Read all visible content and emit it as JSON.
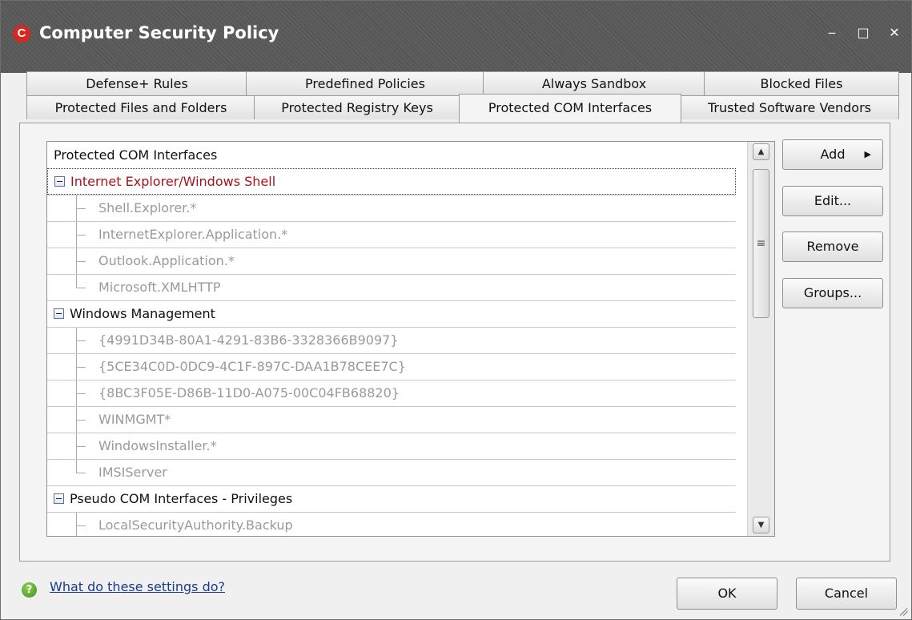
{
  "window": {
    "title": "Computer Security Policy",
    "logo_letter": "C",
    "controls": {
      "minimize": "‒",
      "maximize": "□",
      "close": "✕"
    }
  },
  "tabs": {
    "back_row": [
      "Defense+ Rules",
      "Predefined Policies",
      "Always Sandbox",
      "Blocked Files"
    ],
    "front_row": [
      "Protected Files and Folders",
      "Protected Registry Keys",
      "Protected COM Interfaces",
      "Trusted Software Vendors"
    ],
    "active": "Protected COM Interfaces"
  },
  "tree": {
    "header": "Protected COM Interfaces",
    "groups": [
      {
        "label": "Internet Explorer/Windows Shell",
        "selected": true,
        "items": [
          "Shell.Explorer.*",
          "InternetExplorer.Application.*",
          "Outlook.Application.*",
          "Microsoft.XMLHTTP"
        ]
      },
      {
        "label": "Windows Management",
        "selected": false,
        "items": [
          "{4991D34B-80A1-4291-83B6-3328366B9097}",
          "{5CE34C0D-0DC9-4C1F-897C-DAA1B78CEE7C}",
          "{8BC3F05E-D86B-11D0-A075-00C04FB68820}",
          "WINMGMT*",
          "WindowsInstaller.*",
          "IMSIServer"
        ]
      },
      {
        "label": "Pseudo COM Interfaces - Privileges",
        "selected": false,
        "items": [
          "LocalSecurityAuthority.Backup"
        ]
      }
    ]
  },
  "buttons": {
    "add": "Add",
    "edit": "Edit...",
    "remove": "Remove",
    "groups": "Groups..."
  },
  "footer": {
    "help_link": "What do these settings do?",
    "ok": "OK",
    "cancel": "Cancel"
  },
  "colors": {
    "title_bar": "#5a5a5a",
    "selected_group_text": "#a3141d",
    "item_text": "#9a9a9a"
  }
}
